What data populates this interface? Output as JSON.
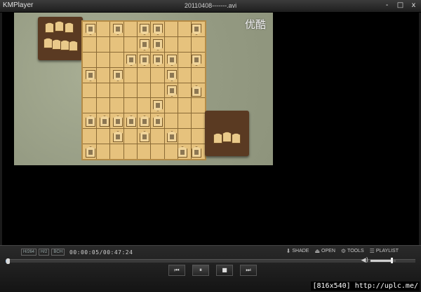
{
  "app": {
    "name": "KMPlayer",
    "window_title": "20110408-------.avi"
  },
  "window_controls": [
    "-",
    "□",
    "x"
  ],
  "video": {
    "watermark": "优酷"
  },
  "status_bar": {
    "tags": [
      "H/264",
      "H/2",
      "BCH"
    ],
    "time": "00:00:05/00:47:24"
  },
  "tools": [
    {
      "icon": "shade-icon",
      "label": "SHADE"
    },
    {
      "icon": "open-icon",
      "label": "OPEN"
    },
    {
      "icon": "tools-icon",
      "label": "TOOLS"
    },
    {
      "icon": "playlist-icon",
      "label": "PLAYLIST"
    }
  ],
  "seek": {
    "progress": 0.0018
  },
  "volume": {
    "level": 0.85
  },
  "transport": [
    {
      "name": "previous-button",
      "symbol": "⏮"
    },
    {
      "name": "pause-button",
      "symbol": "⏸"
    },
    {
      "name": "stop-button",
      "symbol": "■"
    },
    {
      "name": "next-button",
      "symbol": "⏭"
    }
  ],
  "credit": "[816x540] http://uplc.me/",
  "colors": {
    "seek_fill": "#8fb3d6",
    "background": "#1b1b1b"
  }
}
